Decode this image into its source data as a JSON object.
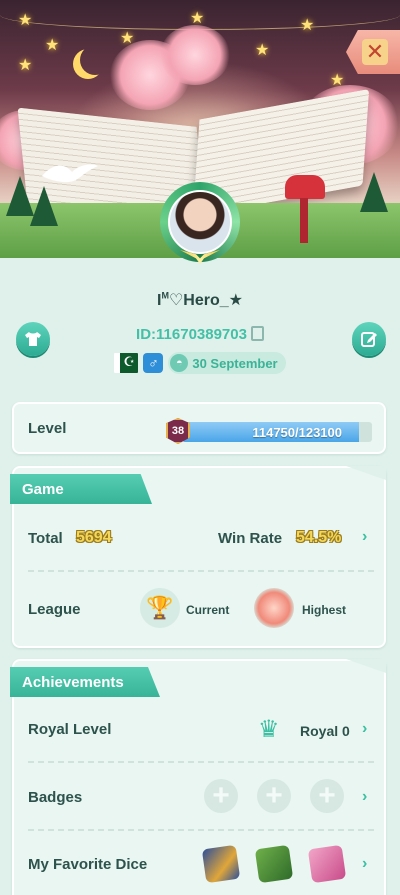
{
  "header": {
    "close_label": "✕"
  },
  "profile": {
    "name_prefix": "I",
    "name_sup": "M",
    "name_mark": "♡",
    "name": "Hero_★",
    "id_text": "ID:11670389703",
    "flag": "Pakistan flag",
    "gender_symbol": "♂",
    "birthday": "30 September"
  },
  "level": {
    "label": "Level",
    "badge": "38",
    "progress_text": "114750/123100",
    "current": 114750,
    "max": 123100
  },
  "game": {
    "section_title": "Game",
    "total_label": "Total",
    "total_value": "5694",
    "winrate_label": "Win Rate",
    "winrate_value": "54.5%",
    "league_label": "League",
    "current_label": "Current",
    "highest_label": "Highest"
  },
  "achievements": {
    "section_title": "Achievements",
    "royal_label": "Royal Level",
    "royal_value": "Royal 0",
    "badges_label": "Badges",
    "dice_label": "My Favorite Dice"
  },
  "icons": {
    "chevron": "›",
    "plus": "+",
    "trophy": "🏆",
    "crown": "♛"
  },
  "colors": {
    "accent": "#37b498",
    "background": "#dff1ea",
    "card": "#e9f6f1",
    "level_bar": "#4aa6e8"
  }
}
